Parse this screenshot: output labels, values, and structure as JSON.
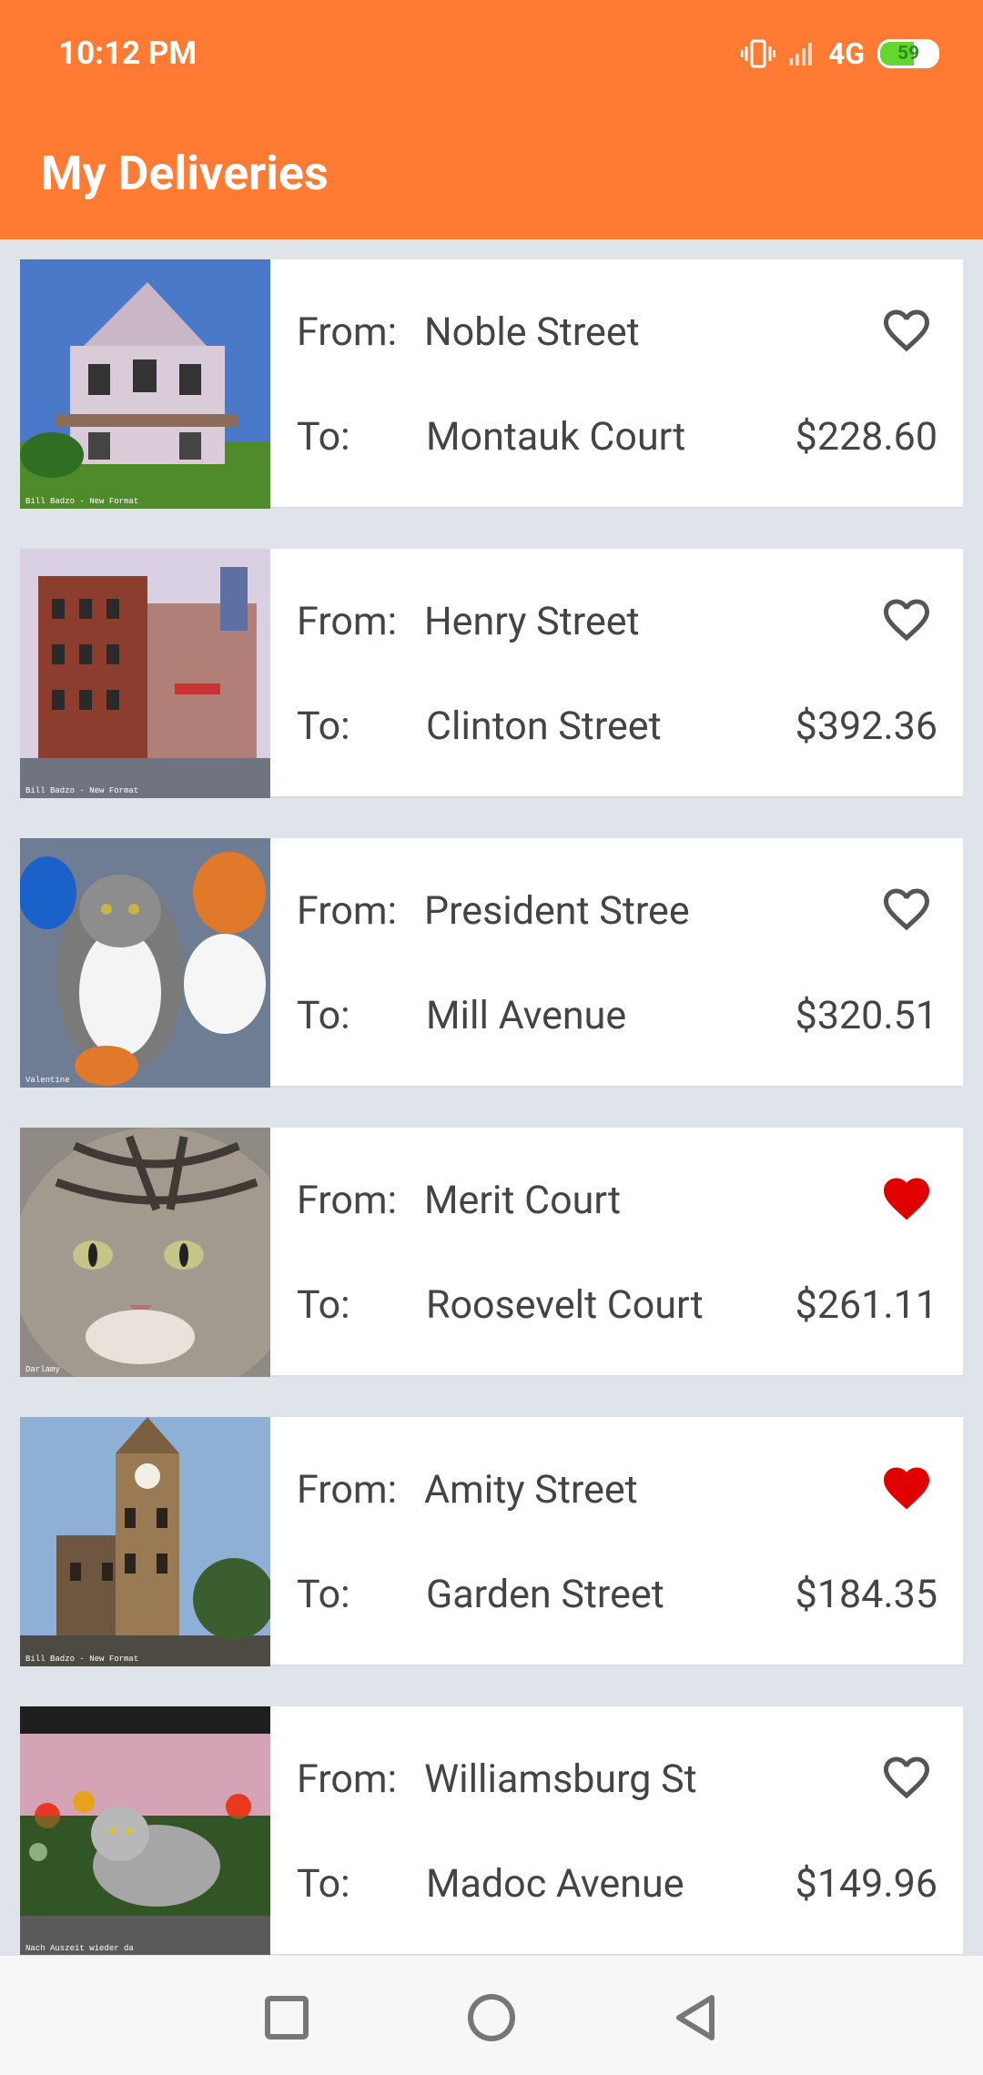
{
  "status_bar": {
    "time": "10:12 PM",
    "network": "4G",
    "battery": "59"
  },
  "header": {
    "title": "My Deliveries"
  },
  "deliveries": [
    {
      "from_label": "From:",
      "from": "Noble Street",
      "to_label": "To:",
      "to": "Montauk Court",
      "price": "$228.60",
      "favorite": false,
      "thumb_caption": "Bill Badzo - New Format"
    },
    {
      "from_label": "From:",
      "from": "Henry Street",
      "to_label": "To:",
      "to": "Clinton Street",
      "price": "$392.36",
      "favorite": false,
      "thumb_caption": "Bill Badzo - New Format"
    },
    {
      "from_label": "From:",
      "from": "President Stree",
      "to_label": "To:",
      "to": "Mill Avenue",
      "price": "$320.51",
      "favorite": false,
      "thumb_caption": "Valentine"
    },
    {
      "from_label": "From:",
      "from": "Merit Court",
      "to_label": "To:",
      "to": "Roosevelt Court",
      "price": "$261.11",
      "favorite": true,
      "thumb_caption": "Darlamy"
    },
    {
      "from_label": "From:",
      "from": "Amity Street",
      "to_label": "To:",
      "to": "Garden Street",
      "price": "$184.35",
      "favorite": true,
      "thumb_caption": "Bill Badzo - New Format"
    },
    {
      "from_label": "From:",
      "from": "Williamsburg St",
      "to_label": "To:",
      "to": "Madoc Avenue",
      "price": "$149.96",
      "favorite": false,
      "thumb_caption": "Nach Auszeit wieder da"
    }
  ],
  "colors": {
    "header": "#ff7a33",
    "favorite_on": "#e00000",
    "favorite_off": "#555555"
  }
}
